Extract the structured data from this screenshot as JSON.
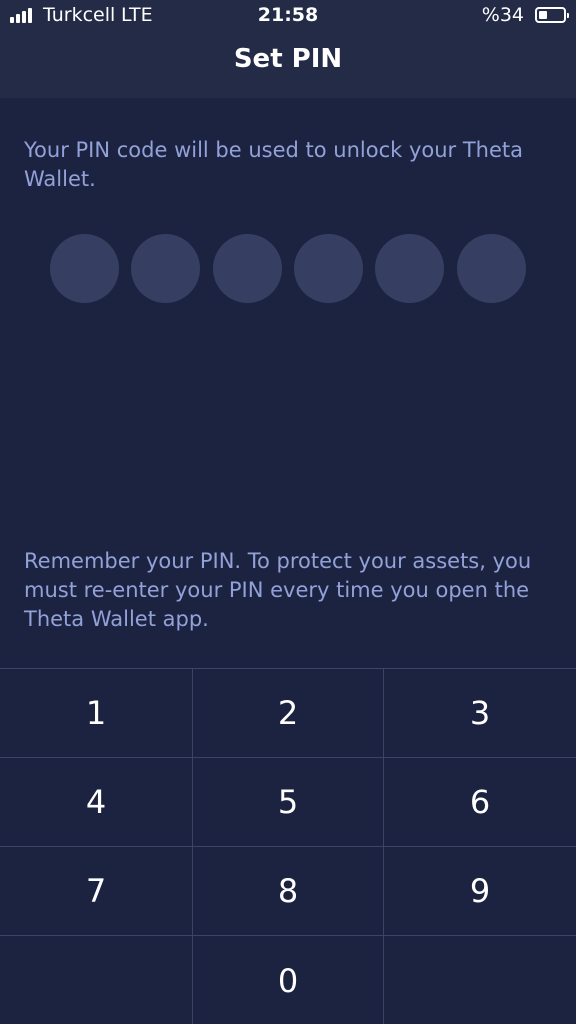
{
  "status_bar": {
    "carrier": "Turkcell",
    "network": "LTE",
    "time": "21:58",
    "battery_percent": "%34",
    "battery_level": 0.34
  },
  "header": {
    "title": "Set PIN"
  },
  "intro_text": "Your PIN code will be used to unlock your Theta Wallet.",
  "pin": {
    "length": 6,
    "entered": 0
  },
  "reminder_text": "Remember your PIN. To protect your assets, you must re-enter your PIN every time you open the Theta Wallet app.",
  "keypad": {
    "keys": [
      "1",
      "2",
      "3",
      "4",
      "5",
      "6",
      "7",
      "8",
      "9",
      "",
      "0",
      ""
    ]
  },
  "colors": {
    "background": "#1c2340",
    "header": "#232b47",
    "accent_text": "#93a1d9",
    "pin_dot": "#363f62",
    "divider": "#3a4467"
  }
}
